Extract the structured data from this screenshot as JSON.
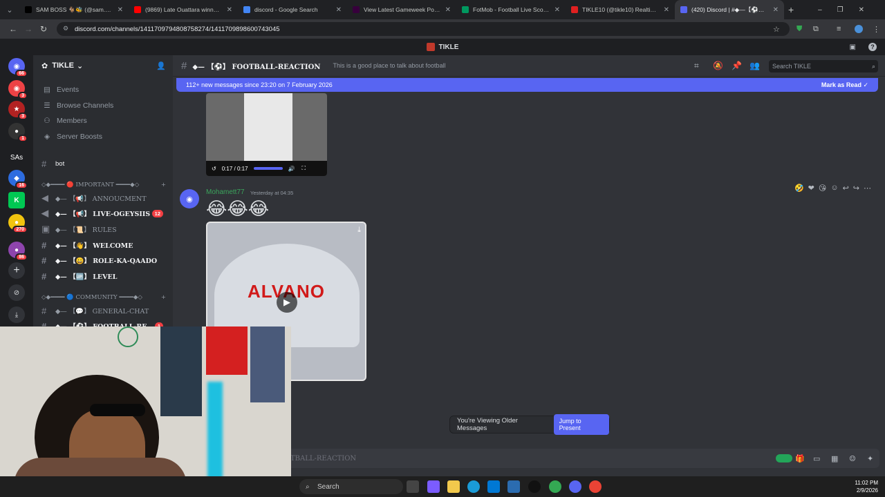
{
  "browser": {
    "tabs": [
      {
        "title": "SAM BOSS 🐐🐝 (@sam.boss...",
        "color": "#000000"
      },
      {
        "title": "(9869) Late Ouattara winner fo...",
        "color": "#ff0000"
      },
      {
        "title": "discord - Google Search",
        "color": "#4285f4"
      },
      {
        "title": "View Latest Gameweek Points |",
        "color": "#37003c"
      },
      {
        "title": "FotMob - Football Live Scores",
        "color": "#00985f"
      },
      {
        "title": "TIKLE10 (@tikle10) Realtime Ki...",
        "color": "#e02020"
      },
      {
        "title": "(420) Discord | #◆—【⚽】FOOT...",
        "color": "#5865f2"
      }
    ],
    "url": "discord.com/channels/1411709794808758274/1411709898600743045"
  },
  "window_title": "TIKLE",
  "server": {
    "name": "TIKLE",
    "links": [
      "Events",
      "Browse Channels",
      "Members",
      "Server Boosts"
    ],
    "bot_channel": "bot",
    "categories": [
      {
        "label": "◇◆━━━━ 🔴 IMPORTANT ━━━━◆◇"
      },
      {
        "label": "◇◆━━━━ 🔵 COMMUNITY ━━━━◆◇"
      }
    ],
    "channels": [
      {
        "name": "◆— 【📢】 ANNOUCMENT",
        "unread": false,
        "count": ""
      },
      {
        "name": "◆— 【📢】 LIVE-OGEYSIIS",
        "unread": true,
        "count": "12"
      },
      {
        "name": "◆— 【📜】 RULES",
        "unread": false,
        "count": ""
      },
      {
        "name": "◆— 【👋】 WELCOME",
        "unread": true,
        "count": ""
      },
      {
        "name": "◆— 【😀】 ROLE-KA-QAADO",
        "unread": true,
        "count": ""
      },
      {
        "name": "◆— 【🆙】 LEVEL",
        "unread": true,
        "count": ""
      },
      {
        "name": "◆— 【💬】 GENERAL-CHAT",
        "unread": false,
        "count": ""
      },
      {
        "name": "◆— 【⚽】 FOOTBALL-RE...",
        "unread": true,
        "count": "1"
      }
    ],
    "guild_badges": [
      "66",
      "3",
      "3",
      "1",
      "16",
      "270",
      "86"
    ],
    "guild_text": "SAs"
  },
  "channel": {
    "name": "◆— 【⚽】 FOOTBALL-REACTION",
    "topic": "This is a good place to talk about football",
    "search_placeholder": "Search TIKLE",
    "new_messages": "112+ new messages since 23:20 on 7 February 2026",
    "mark_read": "Mark as Read"
  },
  "video1": {
    "time": "0:17 / 0:17"
  },
  "message": {
    "author": "Mohamett77",
    "timestamp": "Yesterday at 04:35",
    "emojis": "😂😂😂",
    "video_caption": "ALVANO"
  },
  "older_notice": {
    "label": "You're Viewing Older Messages",
    "jump": "Jump to Present"
  },
  "composer": {
    "placeholder": "TBALL-REACTION"
  },
  "taskbar": {
    "search": "Search",
    "time": "11:02 PM",
    "date": "2/9/2026"
  }
}
